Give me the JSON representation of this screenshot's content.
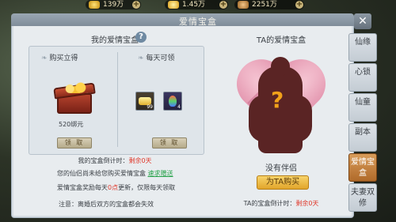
{
  "currency": {
    "gold": "139万",
    "ingot": "1.45万",
    "bag": "2251万"
  },
  "panel": {
    "title": "爱情宝盒",
    "close_label": "✕"
  },
  "left": {
    "title": "我的爱情宝盒",
    "help_label": "?",
    "buy_title": "购买立得",
    "daily_title": "每天可领",
    "price": "520绑元",
    "claim_label_1": "领 取",
    "claim_label_2": "领 取",
    "item1_count": "99",
    "item2_count": "4",
    "countdown_prefix": "我的宝盒倒计时：",
    "countdown_value": "剩余0天",
    "info1_text": "您的仙侣尚未给您购买爱情宝盒",
    "info1_link": "速求赠送",
    "info2_prefix": "爱情宝盒奖励每天",
    "info2_red": "0点",
    "info2_suffix": "更新，仅限每天领取",
    "info3": "注意：离婚后双方的宝盒都会失效"
  },
  "right": {
    "title": "TA的爱情宝盒",
    "qmark": "?",
    "no_partner": "没有伴侣",
    "buy_label": "为TA购买",
    "countdown_prefix": "TA的宝盒倒计时：",
    "countdown_value": "剩余0天"
  },
  "tabs": [
    {
      "label": "仙缘",
      "active": false
    },
    {
      "label": "心锁",
      "active": false
    },
    {
      "label": "仙童",
      "active": false
    },
    {
      "label": "副本",
      "active": false
    },
    {
      "label": "爱情宝盒",
      "active": true
    },
    {
      "label": "夫妻双修",
      "active": false
    }
  ]
}
